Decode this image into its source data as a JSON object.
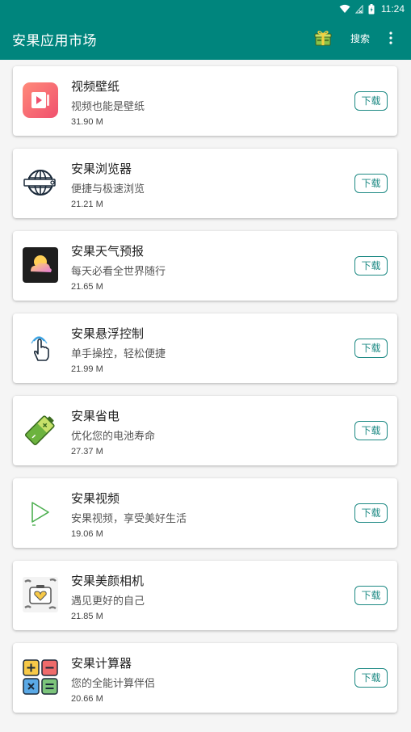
{
  "status_bar": {
    "time": "11:24"
  },
  "toolbar": {
    "title": "安果应用市场",
    "search_label": "搜索",
    "gift_icon": "gift-box-icon",
    "more_icon": "more-vert-icon"
  },
  "colors": {
    "primary": "#00857d",
    "accent": "#1e8a84"
  },
  "apps": [
    {
      "name": "视频壁纸",
      "desc": "视频也能是壁纸",
      "size": "31.90 M",
      "button": "下载",
      "icon": "video-wallpaper-icon"
    },
    {
      "name": "安果浏览器",
      "desc": "便捷与极速浏览",
      "size": "21.21 M",
      "button": "下载",
      "icon": "globe-browser-icon"
    },
    {
      "name": "安果天气预报",
      "desc": "每天必看全世界随行",
      "size": "21.65 M",
      "button": "下载",
      "icon": "weather-icon"
    },
    {
      "name": "安果悬浮控制",
      "desc": "单手操控，轻松便捷",
      "size": "21.99 M",
      "button": "下载",
      "icon": "touch-hand-icon"
    },
    {
      "name": "安果省电",
      "desc": "优化您的电池寿命",
      "size": "27.37 M",
      "button": "下载",
      "icon": "battery-icon"
    },
    {
      "name": "安果视频",
      "desc": "安果视频，享受美好生活",
      "size": "19.06 M",
      "button": "下载",
      "icon": "play-icon"
    },
    {
      "name": "安果美颜相机",
      "desc": "遇见更好的自己",
      "size": "21.85 M",
      "button": "下载",
      "icon": "camera-heart-icon"
    },
    {
      "name": "安果计算器",
      "desc": "您的全能计算伴侣",
      "size": "20.66 M",
      "button": "下载",
      "icon": "calculator-icon"
    }
  ]
}
